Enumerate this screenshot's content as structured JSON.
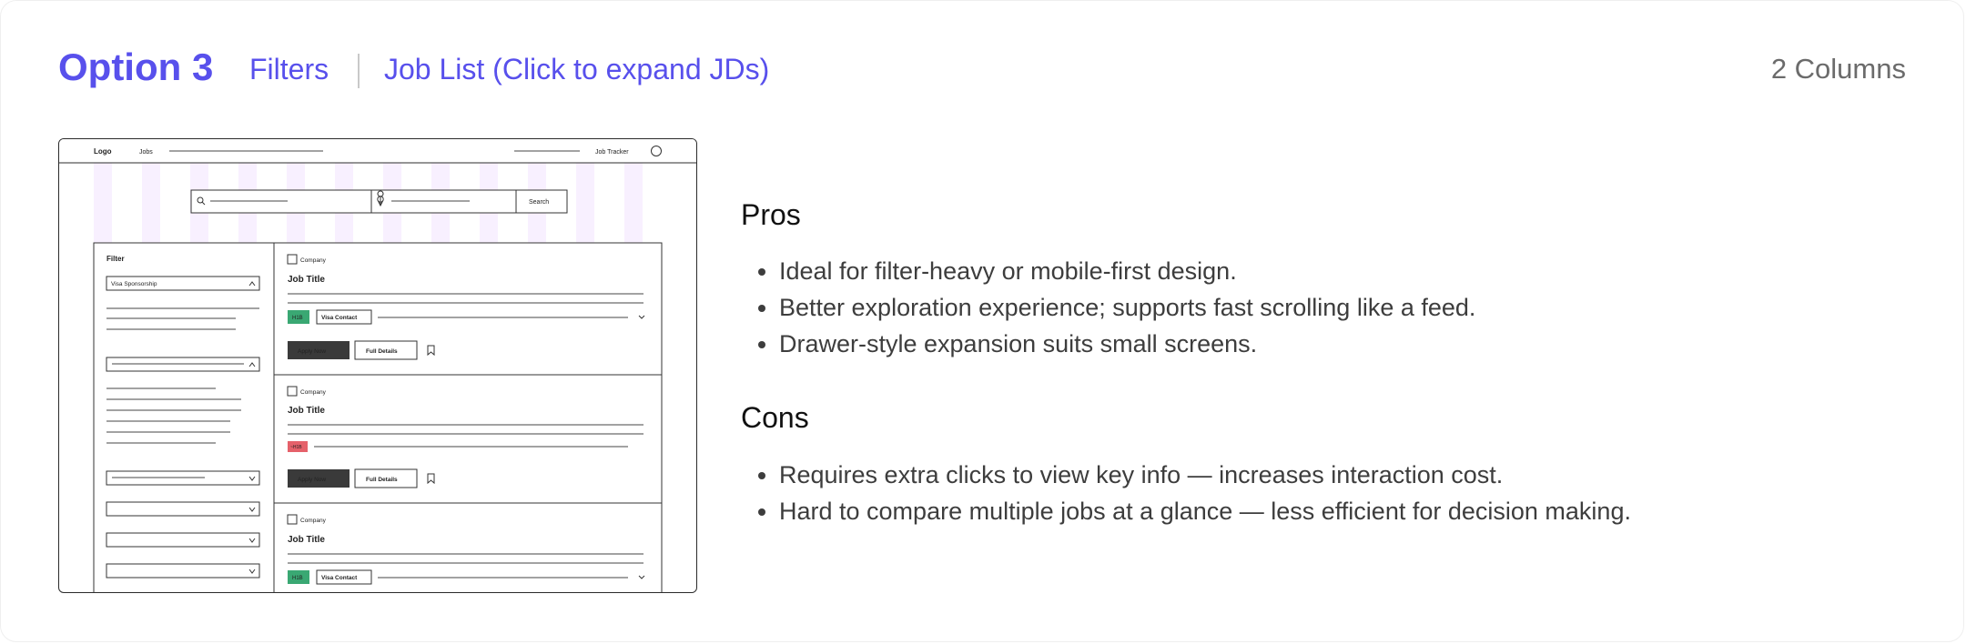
{
  "header": {
    "option_title": "Option 3",
    "nav_filters": "Filters",
    "nav_job_list": "Job List (Click to expand JDs)",
    "columns_label": "2 Columns"
  },
  "wireframe": {
    "logo": "Logo",
    "nav_jobs": "Jobs",
    "job_tracker": "Job Tracker",
    "search_button": "Search",
    "filter_title": "Filter",
    "visa_sponsorship": "Visa Sponsorship",
    "cards": [
      {
        "company": "Company",
        "job_title": "Job Title",
        "tag": "H1B",
        "visa_contact": "Visa Contact",
        "apply": "Apply Now",
        "details": "Full Details"
      },
      {
        "company": "Company",
        "job_title": "Job Title",
        "tag": "~H1B",
        "apply": "Apply Now",
        "details": "Full Details"
      },
      {
        "company": "Company",
        "job_title": "Job Title",
        "tag": "H1B",
        "visa_contact": "Visa Contact"
      }
    ],
    "colors": {
      "tag_green": "#3aa873",
      "tag_red": "#e5616a",
      "column_tint": "#f8f0ff",
      "apply_bg": "#3a3a3a"
    }
  },
  "pros": {
    "heading": "Pros",
    "items": [
      "Ideal for filter-heavy or mobile-first design.",
      "Better exploration experience; supports fast scrolling like a feed.",
      "Drawer-style expansion suits small screens."
    ]
  },
  "cons": {
    "heading": "Cons",
    "items": [
      "Requires extra clicks to view key info — increases interaction cost.",
      "Hard to compare multiple jobs at a glance — less efficient for decision making."
    ]
  },
  "accent_color": "#5850ec"
}
